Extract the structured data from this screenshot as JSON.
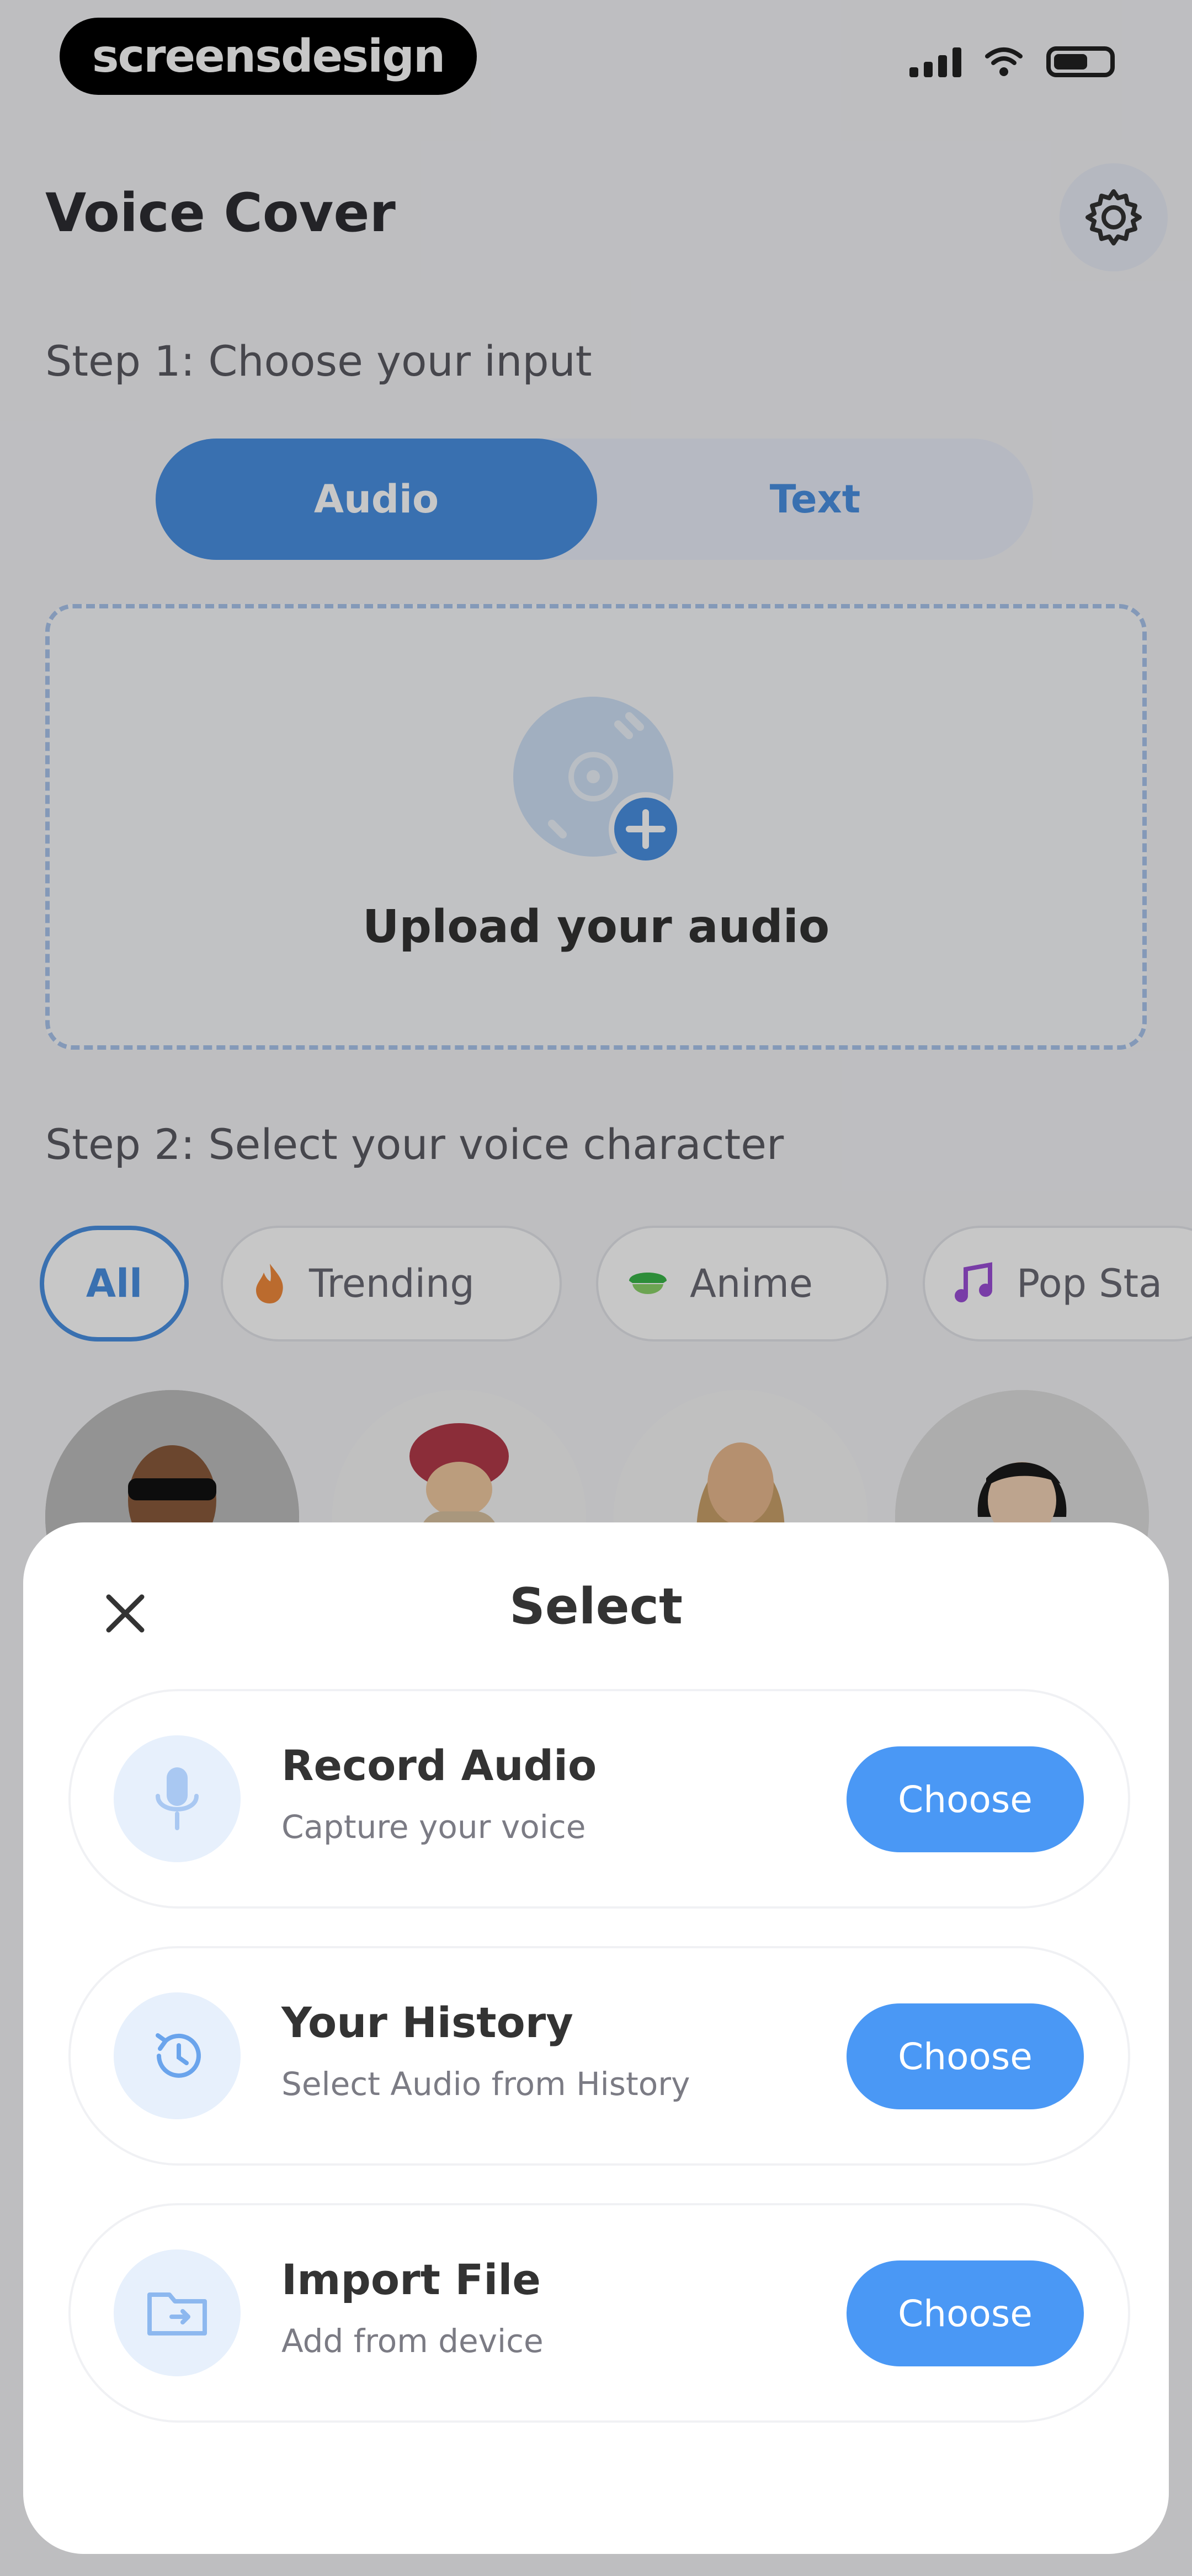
{
  "status_bar": {
    "brand": "screensdesign"
  },
  "header": {
    "title": "Voice Cover"
  },
  "step1": {
    "label": "Step 1: Choose your input",
    "tabs": [
      {
        "label": "Audio",
        "selected": true
      },
      {
        "label": "Text",
        "selected": false
      }
    ]
  },
  "upload": {
    "label": "Upload your audio"
  },
  "step2": {
    "label": "Step 2: Select your voice character",
    "chips": [
      {
        "label": "All",
        "icon": "",
        "selected": true
      },
      {
        "label": "Trending",
        "icon": "fire-icon"
      },
      {
        "label": "Anime",
        "icon": "anime-icon"
      },
      {
        "label": "Pop Sta",
        "icon": "music-note-icon"
      }
    ]
  },
  "sheet": {
    "title": "Select",
    "options": [
      {
        "title": "Record Audio",
        "subtitle": "Capture your voice",
        "icon": "microphone-icon",
        "button": "Choose"
      },
      {
        "title": "Your History",
        "subtitle": "Select Audio from History",
        "icon": "history-icon",
        "button": "Choose"
      },
      {
        "title": "Import File",
        "subtitle": "Add from device",
        "icon": "folder-icon",
        "button": "Choose"
      }
    ]
  },
  "colors": {
    "accent": "#4a90e2",
    "button": "#4a98f5",
    "icon_bg": "#e7f0fc",
    "title": "#333333"
  }
}
